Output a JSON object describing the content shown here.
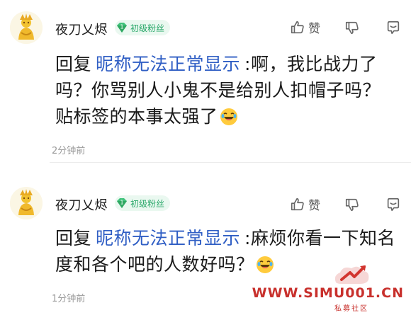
{
  "comments": [
    {
      "user": "夜刀乂烬",
      "badge_level": "1",
      "badge_label": "初级粉丝",
      "like_label": "赞",
      "reply_prefix": "回复",
      "mention": "昵称无法正常显示",
      "text": ":啊，我比战力了吗？你骂别人小鬼不是给别人扣帽子吗？贴标签的本事太强了",
      "time": "2分钟前",
      "icons": [
        "avatar",
        "badge-gem-icon",
        "thumbs-up-icon",
        "thumbs-down-icon",
        "reply-icon",
        "laughing-emoji-icon"
      ]
    },
    {
      "user": "夜刀乂烬",
      "badge_level": "1",
      "badge_label": "初级粉丝",
      "like_label": "赞",
      "reply_prefix": "回复",
      "mention": "昵称无法正常显示",
      "text": ":麻烦你看一下知名度和各个吧的人数好吗？",
      "time": "1分钟前",
      "icons": [
        "avatar",
        "badge-gem-icon",
        "thumbs-up-icon",
        "thumbs-down-icon",
        "reply-icon",
        "laughing-emoji-icon"
      ]
    }
  ],
  "watermark": {
    "text": "WWW.SIMU001.CN",
    "sub": "私募社区"
  },
  "colors": {
    "mention": "#2f5ec4",
    "badge_text": "#2aa86a",
    "badge_bg": "#eaf8f0",
    "watermark": "#c8302c"
  }
}
